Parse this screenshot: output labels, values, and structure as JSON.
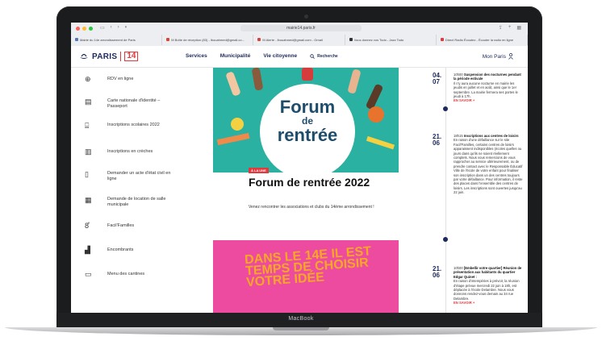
{
  "device": {
    "brand": "MacBook"
  },
  "browser": {
    "url": "mairie14.paris.fr",
    "tabs": [
      {
        "label": "Mairie du 14e arrondissement de Paris"
      },
      {
        "label": "M  Boîte de réception (83) - lbouahmed@gmail.co..."
      },
      {
        "label": "M  Alerte - lbouahmed@gmail.com - Gmail"
      },
      {
        "label": "Vous donnez vos Todo - Jazz Todo"
      },
      {
        "label": "Direct Radio Écoutez - Écouter la radio en ligne"
      }
    ]
  },
  "header": {
    "logo_text": "PARIS",
    "logo_number": "14",
    "nav": [
      "Services",
      "Municipalité",
      "Vie citoyenne"
    ],
    "search_label": "Recherche",
    "account_label": "Mon Paris"
  },
  "sidebar": {
    "items": [
      {
        "label": "RDV en ligne",
        "icon": "globe-icon"
      },
      {
        "label": "Carte nationale d'identité – Passeport",
        "icon": "id-card-icon"
      },
      {
        "label": "Inscriptions scolaires 2022",
        "icon": "backpack-icon"
      },
      {
        "label": "Inscriptions en crèches",
        "icon": "building-icon"
      },
      {
        "label": "Demander un acte d'état civil en ligne",
        "icon": "document-icon"
      },
      {
        "label": "Demande de location de salle municipale",
        "icon": "calendar-icon"
      },
      {
        "label": "Facil'Familles",
        "icon": "family-icon"
      },
      {
        "label": "Encombrants",
        "icon": "bulky-waste-icon"
      },
      {
        "label": "Menu des cantines",
        "icon": "book-icon"
      }
    ]
  },
  "main": {
    "card1": {
      "image_title_1": "Forum",
      "image_title_2": "de",
      "image_title_3": "rentrée",
      "tag": "À LA UNE",
      "title": "Forum de rentrée 2022",
      "description": "Venez rencontrer les associations et clubs du 14ème arrondissement !"
    },
    "card2": {
      "image_text": "DANS LE 14E IL EST TEMPS DE CHOISIR VOTRE IDÉE"
    }
  },
  "timeline": {
    "items": [
      {
        "date_day": "04.",
        "date_month": "07",
        "time": "10h00",
        "title": "Suspension des nocturnes pendant la période estivale",
        "body": "Il n'y aura aucune nocturne en mairie les jeudis en juillet et en août, ainsi que le 1er septembre. La mairie fermera ses portes le jeudi à 17h.",
        "link": "EN SAVOIR +"
      },
      {
        "date_day": "21.",
        "date_month": "06",
        "time": "18h15",
        "title": "Inscriptions aux centres de loisirs",
        "body": "En raison d'une défaillance sur le site Facil'Familles, certains centres de loisirs apparaissent indisponibles (écoles quelles ou jours dans qu'ils ne soient réellement complets. Nous vous remercions de vous rapprocher au service ultérieurement, ou de prendre contact avec le Responsable Éducatif Ville de l'école de votre enfant pour finaliser son inscription dans un des centres toujours par votre défaillance. Pour information, il reste des places dans l'ensemble des centres de loisirs. Les inscriptions sont ouvertes jusqu'au 22 juin."
      },
      {
        "date_day": "21.",
        "date_month": "06",
        "time": "10h00",
        "title": "[Embellir votre quartier] Réunion de présentation aux habitants du quartier Edgar Quinet :",
        "body": "En raison d'intempéries à prévoir, la réunion d'étape prévue mercredi 22 juin à 18h, est déplacée à l'école Delambre. Nous vous donnons rendez-vous demain au 34 rue Delambre.",
        "link": "EN SAVOIR +"
      }
    ]
  },
  "colors": {
    "navy": "#1d2a5a",
    "red": "#e03a3e",
    "teal": "#2bb1a2",
    "pink": "#ec4ba0",
    "orange": "#f6a823"
  }
}
